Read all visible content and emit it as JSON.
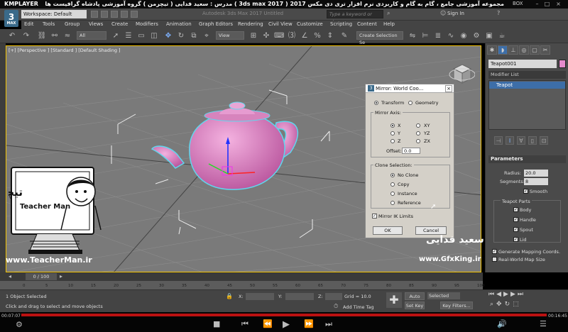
{
  "player": {
    "logo": "KMPLAYER",
    "boxtag": "BOX",
    "banner": "مجموعه آموزشی جامع ، گام به گام و کاربردی نرم افزار تری دی مکس 2017 ( 3ds max 2017 ) مدرس : سعید فدایی ( تیچرمن ) گروه آموزشی پادشاه گرافیست ها",
    "time_left": "00:07:07",
    "time_right": "00:16:45"
  },
  "app": {
    "logo": "3",
    "logo_sub": "MAX",
    "workspace": "Workspace: Default",
    "title": "Autodesk 3ds Max 2017    Untitled",
    "search_placeholder": "Type a keyword or phrase",
    "signin": "Sign In",
    "menu": [
      "Edit",
      "Tools",
      "Group",
      "Views",
      "Create",
      "Modifiers",
      "Animation",
      "Graph Editors",
      "Rendering",
      "Civil View",
      "Customize",
      "Scripting",
      "Content",
      "Help"
    ]
  },
  "toolbar": {
    "filter": "All",
    "ref_coord": "View",
    "selection_set": "Create Selection Se"
  },
  "viewport": {
    "label": "[+] [Perspective ] [Standard ] [Default Shading ]",
    "teapot_color": "#e58acb",
    "selection_color": "#5fd7ee"
  },
  "command_panel": {
    "object_name": "Teapot001",
    "modifier_list": "Modifier List",
    "stack_item": "Teapot",
    "params_title": "Parameters",
    "radius_label": "Radius:",
    "radius_value": "20.0",
    "segments_label": "Segments:",
    "segments_value": "8",
    "smooth": "Smooth",
    "parts_label": "Teapot Parts",
    "parts": [
      "Body",
      "Handle",
      "Spout",
      "Lid"
    ],
    "gen_mapping": "Generate Mapping Coords.",
    "real_world": "Real-World Map Size"
  },
  "mirror_dialog": {
    "title": "Mirror: World Coo...",
    "transform": "Transform",
    "geometry": "Geometry",
    "mirror_axis_label": "Mirror Axis:",
    "axes_left": [
      "X",
      "Y",
      "Z"
    ],
    "axes_right": [
      "XY",
      "YZ",
      "ZX"
    ],
    "offset_label": "Offset:",
    "offset_value": "0.0",
    "clone_label": "Clone Selection:",
    "clone_options": [
      "No Clone",
      "Copy",
      "Instance",
      "Reference"
    ],
    "mirror_ik": "Mirror IK Limits",
    "ok": "OK",
    "cancel": "Cancel"
  },
  "timeline": {
    "frame_counter": "0 / 100",
    "ticks": [
      "0",
      "5",
      "10",
      "15",
      "20",
      "25",
      "30",
      "35",
      "40",
      "45",
      "50",
      "55",
      "60",
      "65",
      "70",
      "75",
      "80",
      "85",
      "90",
      "95",
      "100"
    ]
  },
  "status": {
    "selected": "1 Object Selected",
    "prompt": "Click and drag to select and move objects",
    "x_label": "X:",
    "y_label": "Y:",
    "z_label": "Z:",
    "grid": "Grid = 10.0",
    "add_time_tag": "Add Time Tag",
    "auto_key": "Auto Key",
    "set_key": "Set Key",
    "selected_dd": "Selected",
    "key_filters": "Key Filters..."
  },
  "overlay": {
    "presenter_name": "Teacher Man",
    "presenter_fa": "تیچرمن",
    "site_left": "www.TeacherMan.ir",
    "site_right": "www.GfxKing.ir",
    "watermark": "سعید فدایی"
  }
}
